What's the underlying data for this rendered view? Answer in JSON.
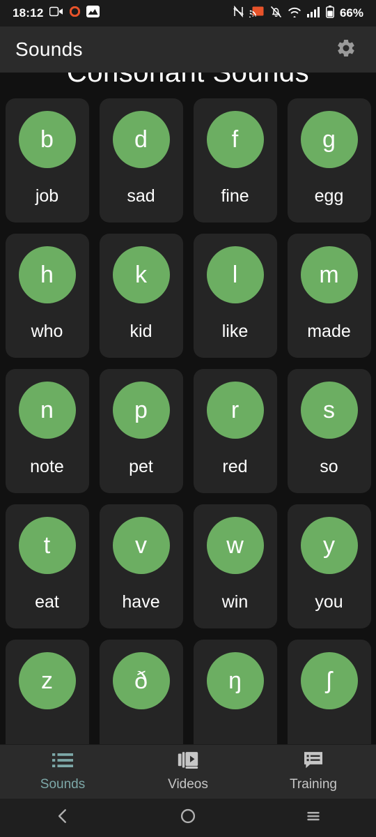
{
  "status_bar": {
    "time": "18:12",
    "battery_percent": "66%",
    "left_icons": [
      "video-camera-icon",
      "record-dot-icon",
      "screenshot-icon"
    ],
    "right_icons": [
      "nfc-icon",
      "cast-icon",
      "notifications-muted-icon",
      "wifi-icon",
      "cellular-signal-icon",
      "battery-icon"
    ],
    "accent_record": "#e8532a"
  },
  "app_bar": {
    "title": "Sounds",
    "settings_icon": "gear-icon",
    "background": "#2b2b2b"
  },
  "main": {
    "section_title": "Consonant Sounds",
    "accent_green": "#6cae62",
    "card_background": "#252525",
    "page_background": "#111111",
    "cards": [
      {
        "symbol": "b",
        "word": "job"
      },
      {
        "symbol": "d",
        "word": "sad"
      },
      {
        "symbol": "f",
        "word": "fine"
      },
      {
        "symbol": "g",
        "word": "egg"
      },
      {
        "symbol": "h",
        "word": "who"
      },
      {
        "symbol": "k",
        "word": "kid"
      },
      {
        "symbol": "l",
        "word": "like"
      },
      {
        "symbol": "m",
        "word": "made"
      },
      {
        "symbol": "n",
        "word": "note"
      },
      {
        "symbol": "p",
        "word": "pet"
      },
      {
        "symbol": "r",
        "word": "red"
      },
      {
        "symbol": "s",
        "word": "so"
      },
      {
        "symbol": "t",
        "word": "eat"
      },
      {
        "symbol": "v",
        "word": "have"
      },
      {
        "symbol": "w",
        "word": "win"
      },
      {
        "symbol": "y",
        "word": "you"
      },
      {
        "symbol": "z",
        "word": ""
      },
      {
        "symbol": "ð",
        "word": ""
      },
      {
        "symbol": "ŋ",
        "word": ""
      },
      {
        "symbol": "ʃ",
        "word": ""
      }
    ]
  },
  "bottom_nav": {
    "active_color": "#7da8a8",
    "inactive_color": "#c6c6c6",
    "items": [
      {
        "label": "Sounds",
        "icon": "list-icon",
        "active": true
      },
      {
        "label": "Videos",
        "icon": "video-library-icon",
        "active": false
      },
      {
        "label": "Training",
        "icon": "comment-list-icon",
        "active": false
      }
    ]
  },
  "system_nav": {
    "buttons": [
      {
        "icon": "back-chevron-icon"
      },
      {
        "icon": "home-circle-icon"
      },
      {
        "icon": "recents-menu-icon"
      }
    ]
  }
}
